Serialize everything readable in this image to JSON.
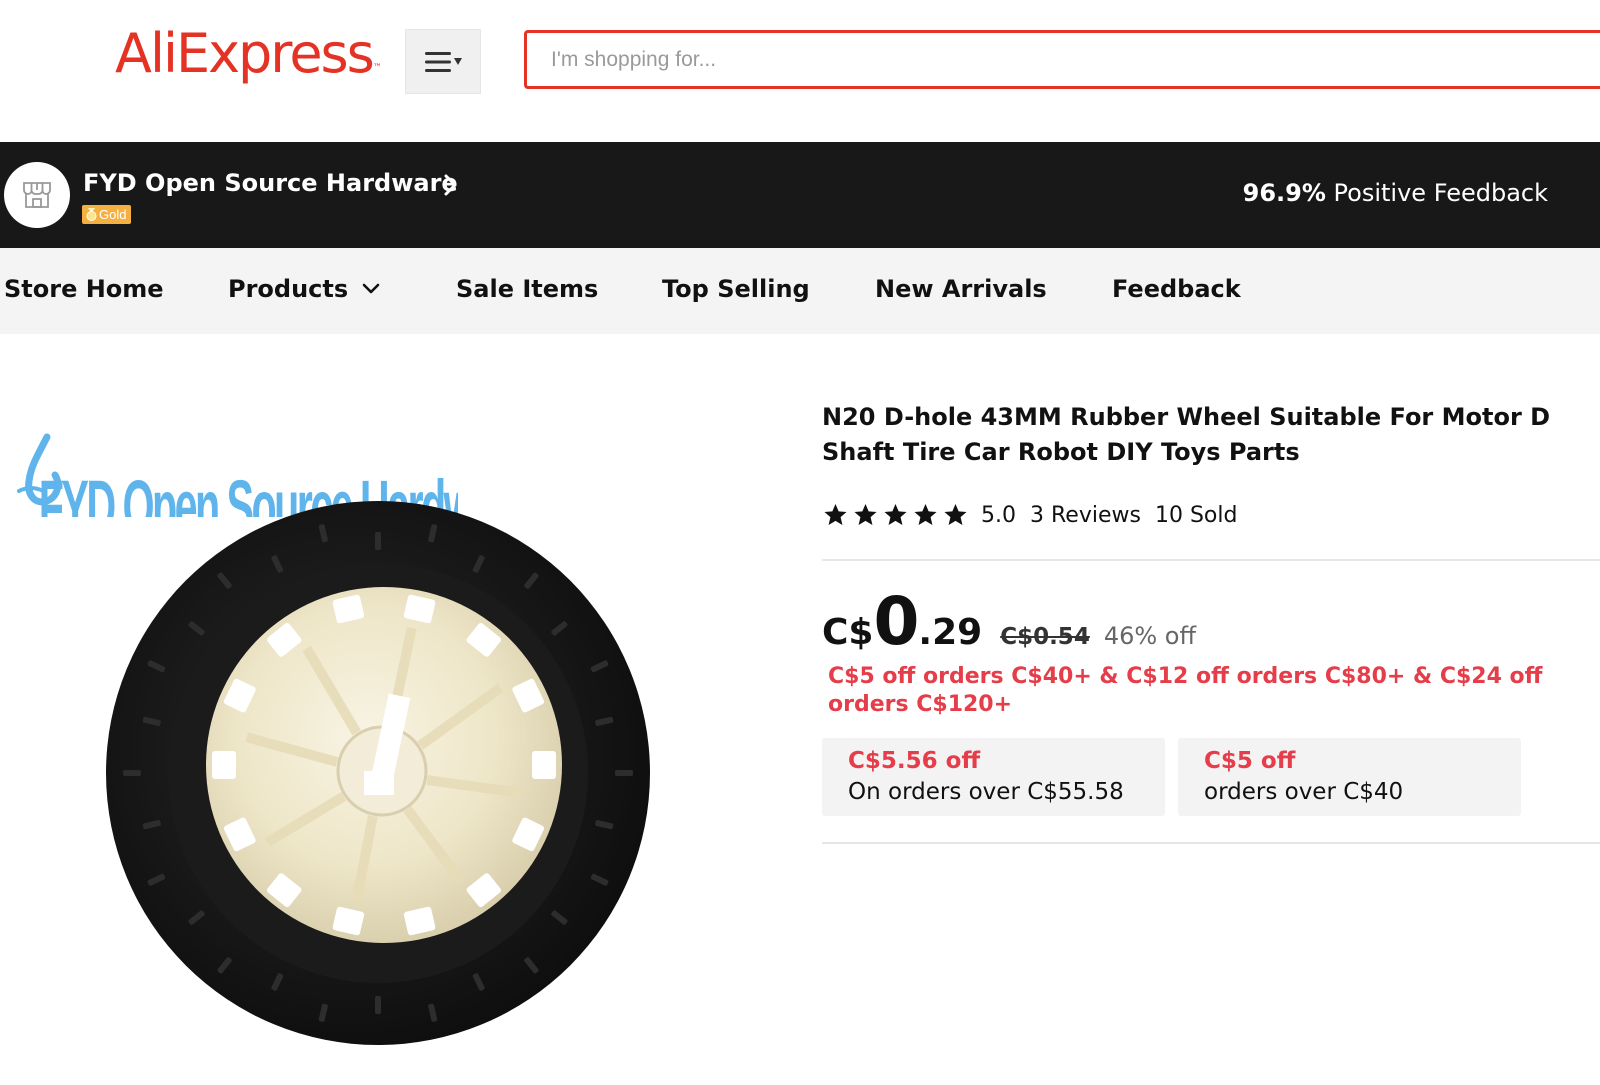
{
  "header": {
    "logo_text": "AliExpress",
    "logo_tm": "™",
    "category_menu_icon": "hamburger-menu-icon",
    "search": {
      "placeholder": "I'm shopping for...",
      "value": ""
    }
  },
  "store": {
    "name": "FYD Open Source Hardware",
    "badge": "Gold",
    "feedback_percent": "96.9%",
    "feedback_label": "Positive Feedback",
    "avatar_icon": "store-icon"
  },
  "store_nav": {
    "items": [
      {
        "label": "Store Home"
      },
      {
        "label": "Products",
        "has_dropdown": true
      },
      {
        "label": "Sale Items"
      },
      {
        "label": "Top Selling"
      },
      {
        "label": "New Arrivals"
      },
      {
        "label": "Feedback"
      }
    ]
  },
  "product": {
    "image_watermark": "FYD Open Source Hardware",
    "title": "N20 D-hole 43MM Rubber Wheel Suitable For Motor D Shaft Tire Car Robot DIY Toys Parts",
    "rating": {
      "stars": 5,
      "value": "5.0",
      "reviews": "3 Reviews",
      "sold": "10 Sold"
    },
    "price": {
      "currency": "C$",
      "integer": "0",
      "decimal": ".29",
      "original": "C$0.54",
      "discount": "46% off"
    },
    "store_promo": "C$5 off orders C$40+ & C$12 off orders C$80+ & C$24 off orders C$120+",
    "coupons": [
      {
        "amount": "C$5.56 off",
        "condition": "On orders over C$55.58"
      },
      {
        "amount": "C$5 off",
        "condition": "orders over C$40"
      }
    ]
  },
  "colors": {
    "brand_red": "#e43225",
    "promo_red": "#e53e4a",
    "store_bar": "#181818",
    "nav_bg": "#f4f4f4",
    "gold_badge": "#f5b042",
    "watermark_blue": "#5fb4ec"
  }
}
